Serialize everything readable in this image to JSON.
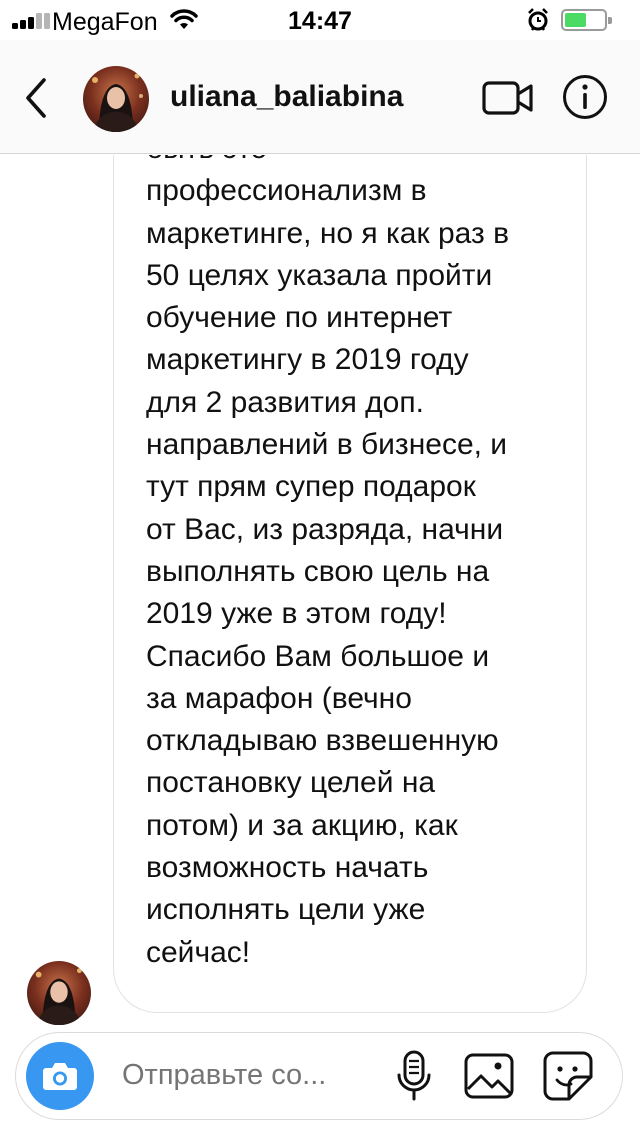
{
  "status_bar": {
    "carrier": "MegaFon",
    "time": "14:47",
    "battery_level": 0.55,
    "colors": {
      "battery": "#4cd964"
    }
  },
  "header": {
    "username": "uliana_baliabina",
    "icons": [
      "back-chevron-icon",
      "avatar",
      "video-call-icon",
      "info-icon"
    ]
  },
  "message": {
    "lines": [
      "быть это",
      "профессионализм в",
      "маркетинге, но я как раз в",
      "50 целях указала пройти",
      "обучение по интернет",
      "маркетингу в 2019 году",
      "для 2 развития доп.",
      "направлений в бизнесе, и",
      "тут прям супер подарок",
      "от Вас, из разряда, начни",
      "выполнять свою цель на",
      "2019 уже в этом году!",
      "Спасибо Вам большое и",
      "за марафон (вечно",
      "откладываю взвешенную",
      "постановку целей на",
      "потом) и за акцию, как",
      "возможность начать",
      "исполнять цели уже",
      "сейчас!"
    ]
  },
  "composer": {
    "placeholder": "Отправьте со...",
    "icons": [
      "camera-icon",
      "microphone-icon",
      "gallery-icon",
      "sticker-icon"
    ],
    "colors": {
      "camera_button": "#3897f0"
    }
  }
}
